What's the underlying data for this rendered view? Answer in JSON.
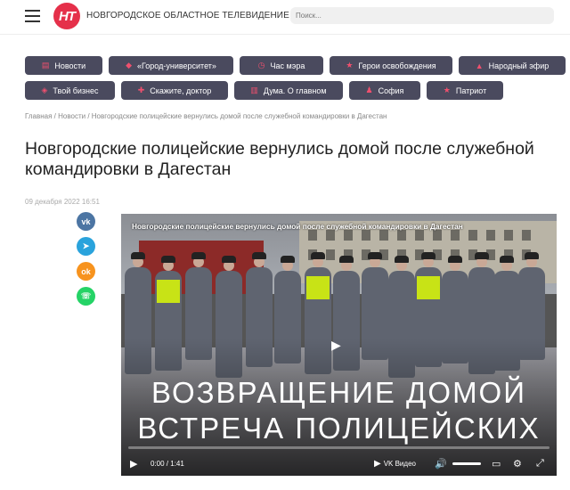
{
  "header": {
    "logo_text": "НТ",
    "brand": "НОВГОРОДСКОЕ ОБЛАСТНОЕ ТЕЛЕВИДЕНИЕ",
    "search_placeholder": "Поиск..."
  },
  "nav": {
    "row1": [
      {
        "label": "Новости",
        "icon": "newspaper-icon",
        "glyph": "▤"
      },
      {
        "label": "«Город-университет»",
        "icon": "graduation-cap-icon",
        "glyph": "◆"
      },
      {
        "label": "Час мэра",
        "icon": "clock-icon",
        "glyph": "◷"
      },
      {
        "label": "Герои освобождения",
        "icon": "star-icon",
        "glyph": "★"
      },
      {
        "label": "Народный эфир",
        "icon": "thumbs-up-icon",
        "glyph": "▲"
      }
    ],
    "row2": [
      {
        "label": "Твой бизнес",
        "icon": "chart-icon",
        "glyph": "◈"
      },
      {
        "label": "Скажите, доктор",
        "icon": "doctor-icon",
        "glyph": "✚"
      },
      {
        "label": "Дума. О главном",
        "icon": "building-icon",
        "glyph": "▥"
      },
      {
        "label": "София",
        "icon": "person-icon",
        "glyph": "♟"
      },
      {
        "label": "Патриот",
        "icon": "star-icon",
        "glyph": "★"
      }
    ]
  },
  "breadcrumb": {
    "home": "Главная",
    "sep1": " / ",
    "section": "Новости",
    "sep2": " / ",
    "current": "Новгородские полицейские вернулись домой после служебной командировки в Дагестан"
  },
  "article": {
    "title": "Новгородские полицейские вернулись домой после служебной командировки в Дагестан",
    "date": "09 декабря 2022 16:51"
  },
  "share": [
    {
      "name": "vk-share-icon",
      "glyph": "vk",
      "color": "#4c75a3"
    },
    {
      "name": "telegram-share-icon",
      "glyph": "➤",
      "color": "#2aa3dc"
    },
    {
      "name": "odnoklassniki-share-icon",
      "glyph": "ok",
      "color": "#f7931e"
    },
    {
      "name": "whatsapp-share-icon",
      "glyph": "☏",
      "color": "#25d366"
    }
  ],
  "video": {
    "title": "Новгородские полицейские вернулись домой после служебной командировки в Дагестан",
    "caption_line1": "ВОЗВРАЩЕНИЕ ДОМОЙ",
    "caption_line2": "ВСТРЕЧА ПОЛИЦЕЙСКИХ",
    "time": "0:00 / 1:41",
    "progress": 0,
    "player_brand": "VK Видео"
  }
}
